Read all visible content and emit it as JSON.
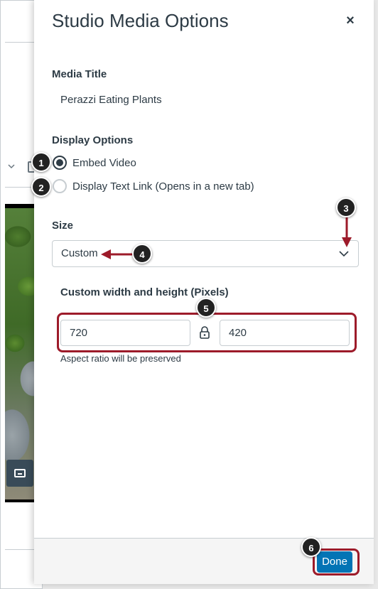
{
  "dialog": {
    "title": "Studio Media Options",
    "close_label": "×"
  },
  "media_title": {
    "label": "Media Title",
    "value": "Perazzi Eating Plants"
  },
  "display_options": {
    "label": "Display Options",
    "options": [
      {
        "label": "Embed Video",
        "selected": true
      },
      {
        "label": "Display Text Link (Opens in a new tab)",
        "selected": false
      }
    ]
  },
  "size": {
    "label": "Size",
    "selected": "Custom"
  },
  "custom_dimensions": {
    "label": "Custom width and height (Pixels)",
    "width": "720",
    "height": "420",
    "hint": "Aspect ratio will be preserved"
  },
  "footer": {
    "done_label": "Done"
  },
  "callouts": [
    "1",
    "2",
    "3",
    "4",
    "5",
    "6"
  ],
  "colors": {
    "primary_button": "#0374b5",
    "highlight": "#9d1b2a",
    "callout": "#222222",
    "text": "#2d3b45",
    "border": "#c7cdd1"
  }
}
